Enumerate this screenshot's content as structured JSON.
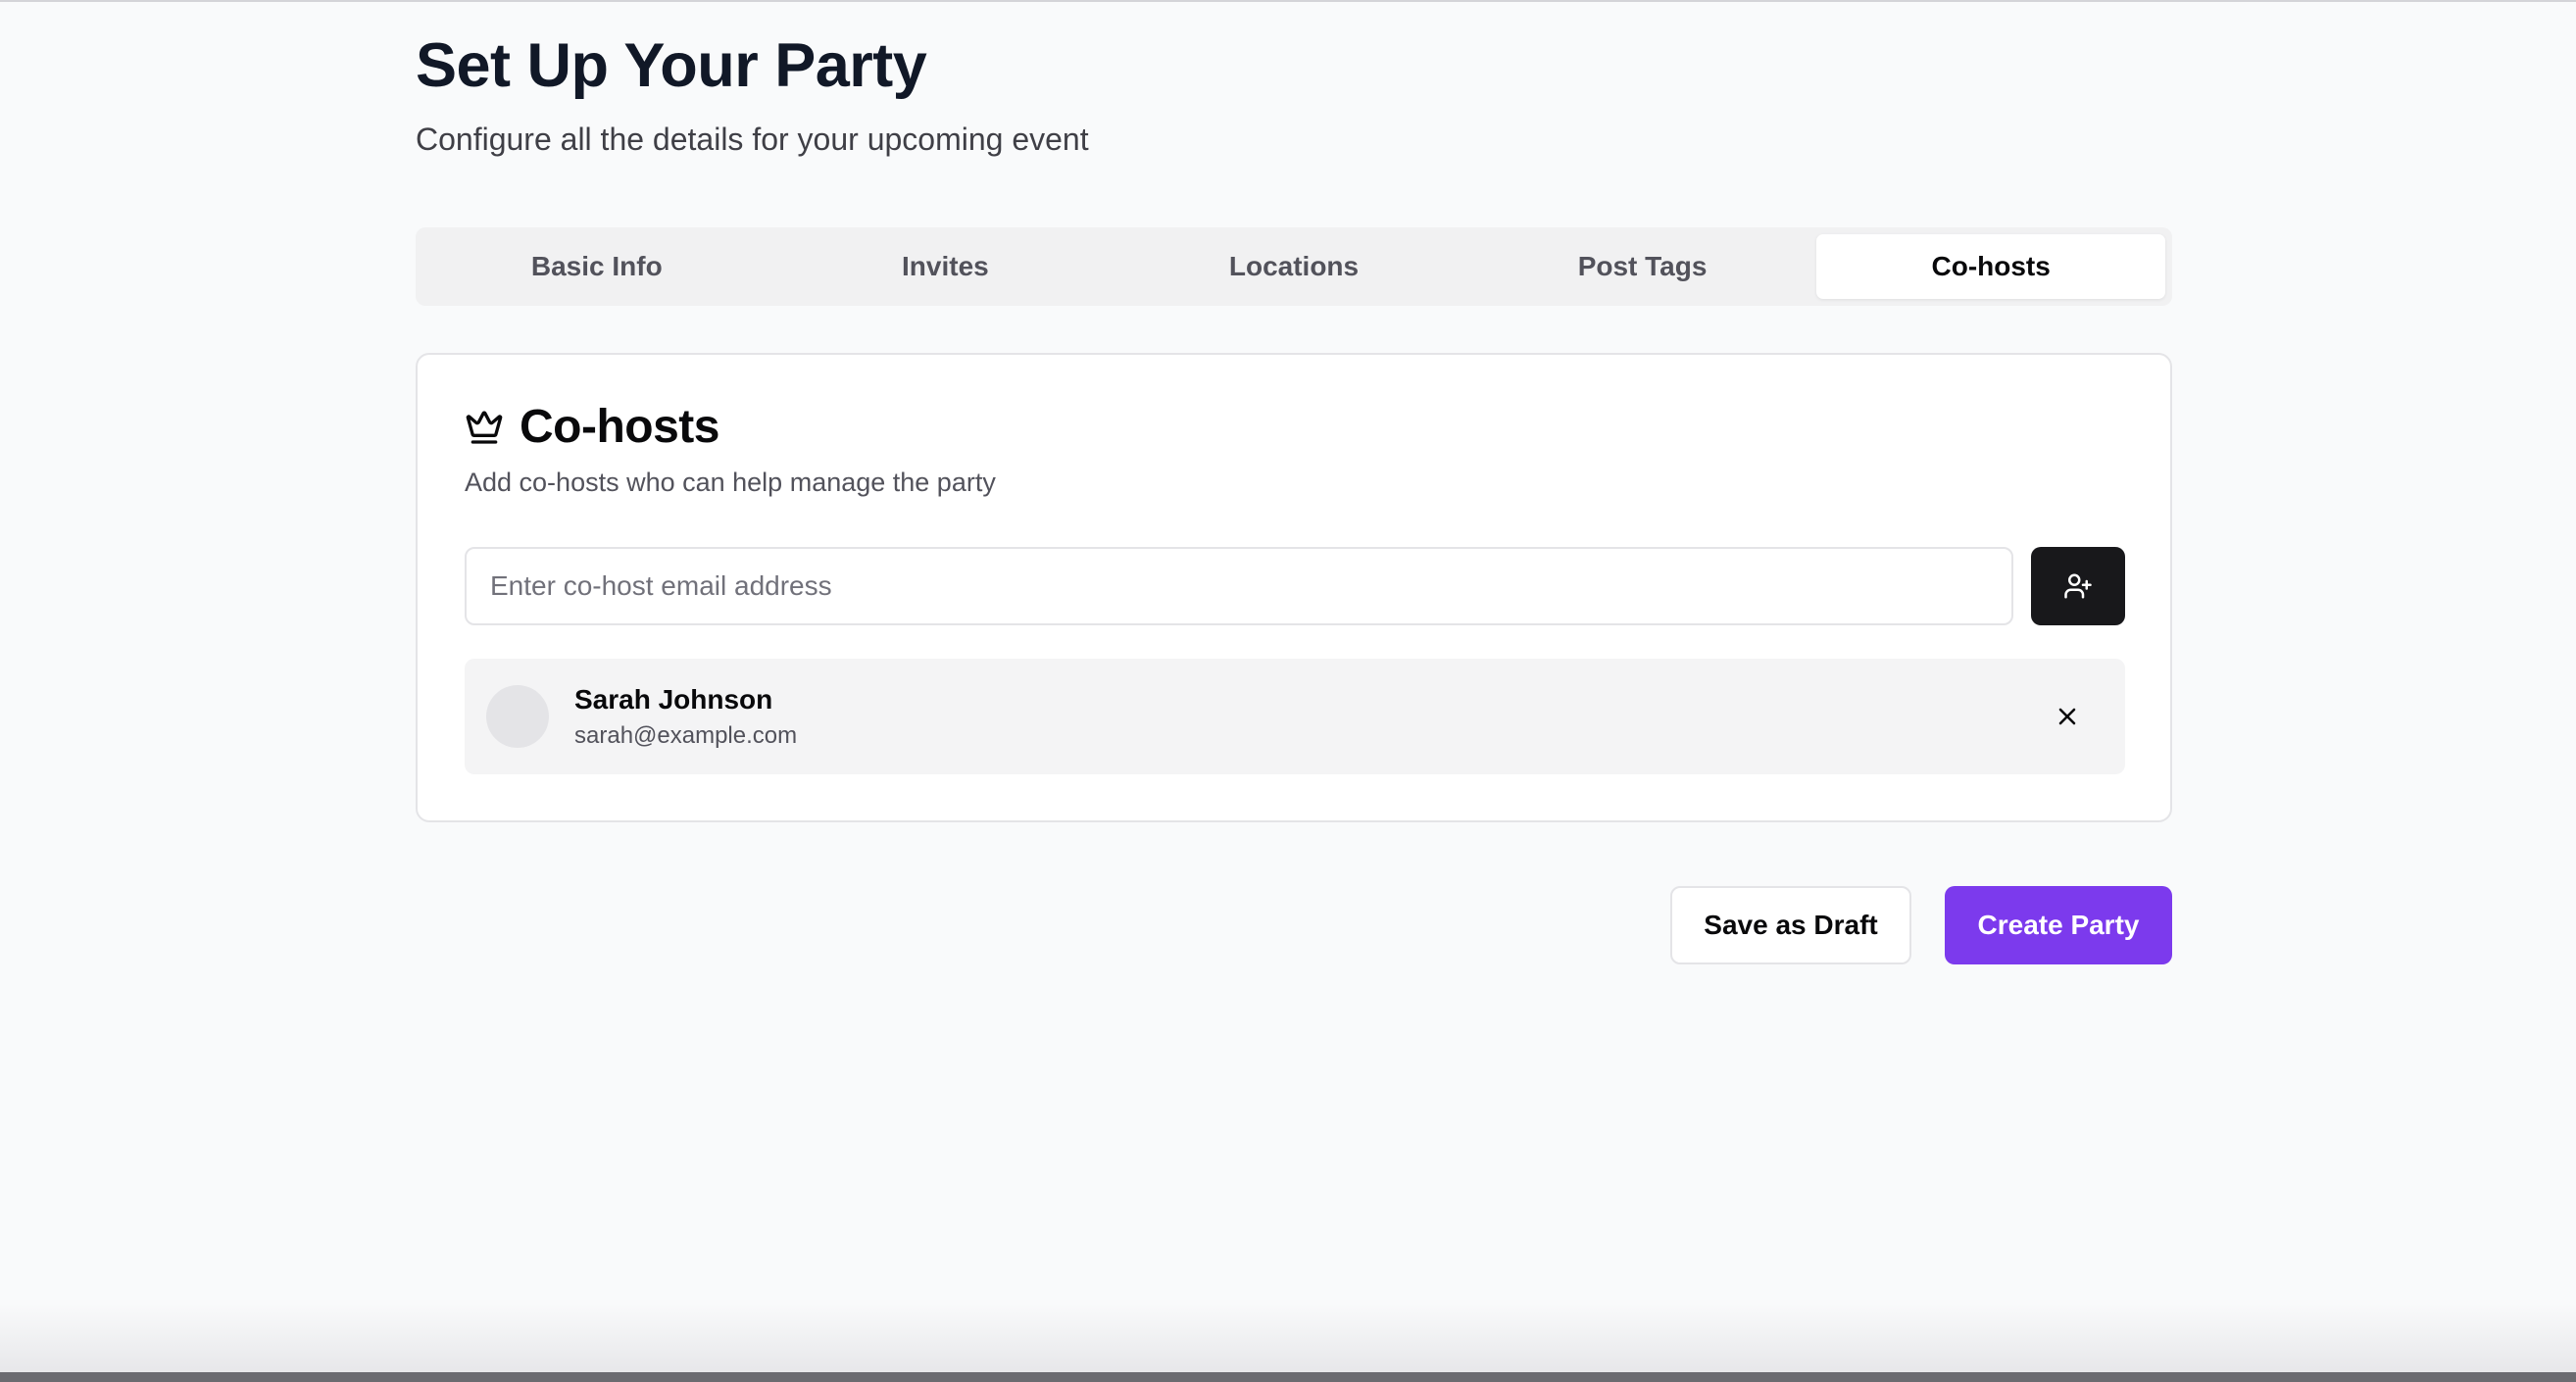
{
  "header": {
    "title": "Set Up Your Party",
    "subtitle": "Configure all the details for your upcoming event"
  },
  "tabs": [
    {
      "label": "Basic Info",
      "active": false
    },
    {
      "label": "Invites",
      "active": false
    },
    {
      "label": "Locations",
      "active": false
    },
    {
      "label": "Post Tags",
      "active": false
    },
    {
      "label": "Co-hosts",
      "active": true
    }
  ],
  "cohosts_card": {
    "icon": "crown-icon",
    "title": "Co-hosts",
    "description": "Add co-hosts who can help manage the party",
    "email_input": {
      "value": "",
      "placeholder": "Enter co-host email address"
    },
    "add_button_icon": "user-plus-icon",
    "cohosts": [
      {
        "name": "Sarah Johnson",
        "email": "sarah@example.com",
        "remove_icon": "close-icon"
      }
    ]
  },
  "actions": {
    "save_draft_label": "Save as Draft",
    "create_label": "Create Party"
  },
  "colors": {
    "accent": "#7c3aed",
    "dark_button": "#18181b",
    "background": "#f9fafb"
  }
}
